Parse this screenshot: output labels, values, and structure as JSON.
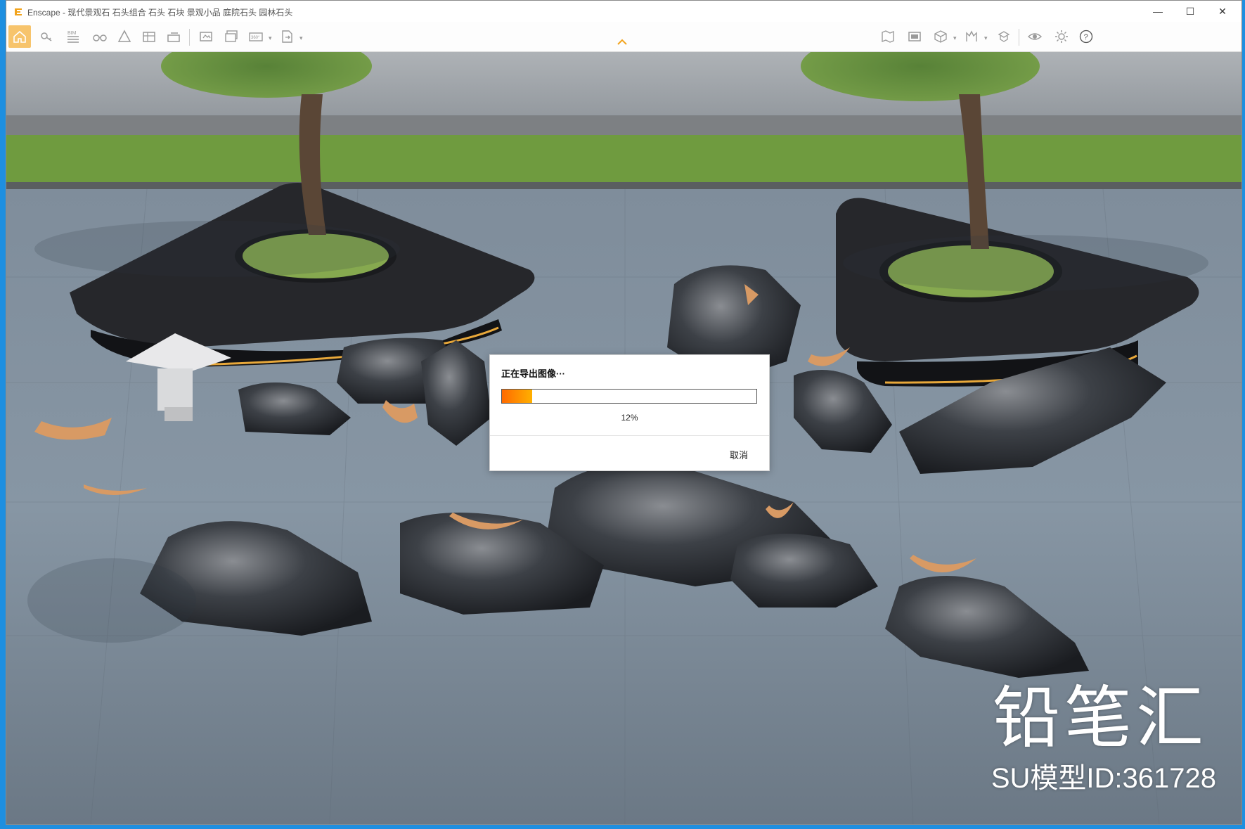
{
  "window": {
    "app_name": "Enscape",
    "title": "Enscape - 现代景观石 石头组合 石头 石块 景观小品 庭院石头 园林石头"
  },
  "titlebar": {
    "minimize_glyph": "—",
    "maximize_glyph": "☐",
    "close_glyph": "✕"
  },
  "toolbar": {
    "bim_label": "BIM",
    "pano_label": "360°",
    "help_glyph": "?"
  },
  "dialog": {
    "title": "正在导出图像···",
    "progress": 0.12,
    "progress_text": "12%",
    "cancel_label": "取消"
  },
  "watermark": {
    "logo_text": "铅笔汇",
    "model_id_text": "SU模型ID:361728"
  },
  "colors": {
    "accent": "#f2a31b",
    "progress_start": "#ff6a00",
    "progress_end": "#ffb000",
    "desktop": "#1e8fe0"
  }
}
